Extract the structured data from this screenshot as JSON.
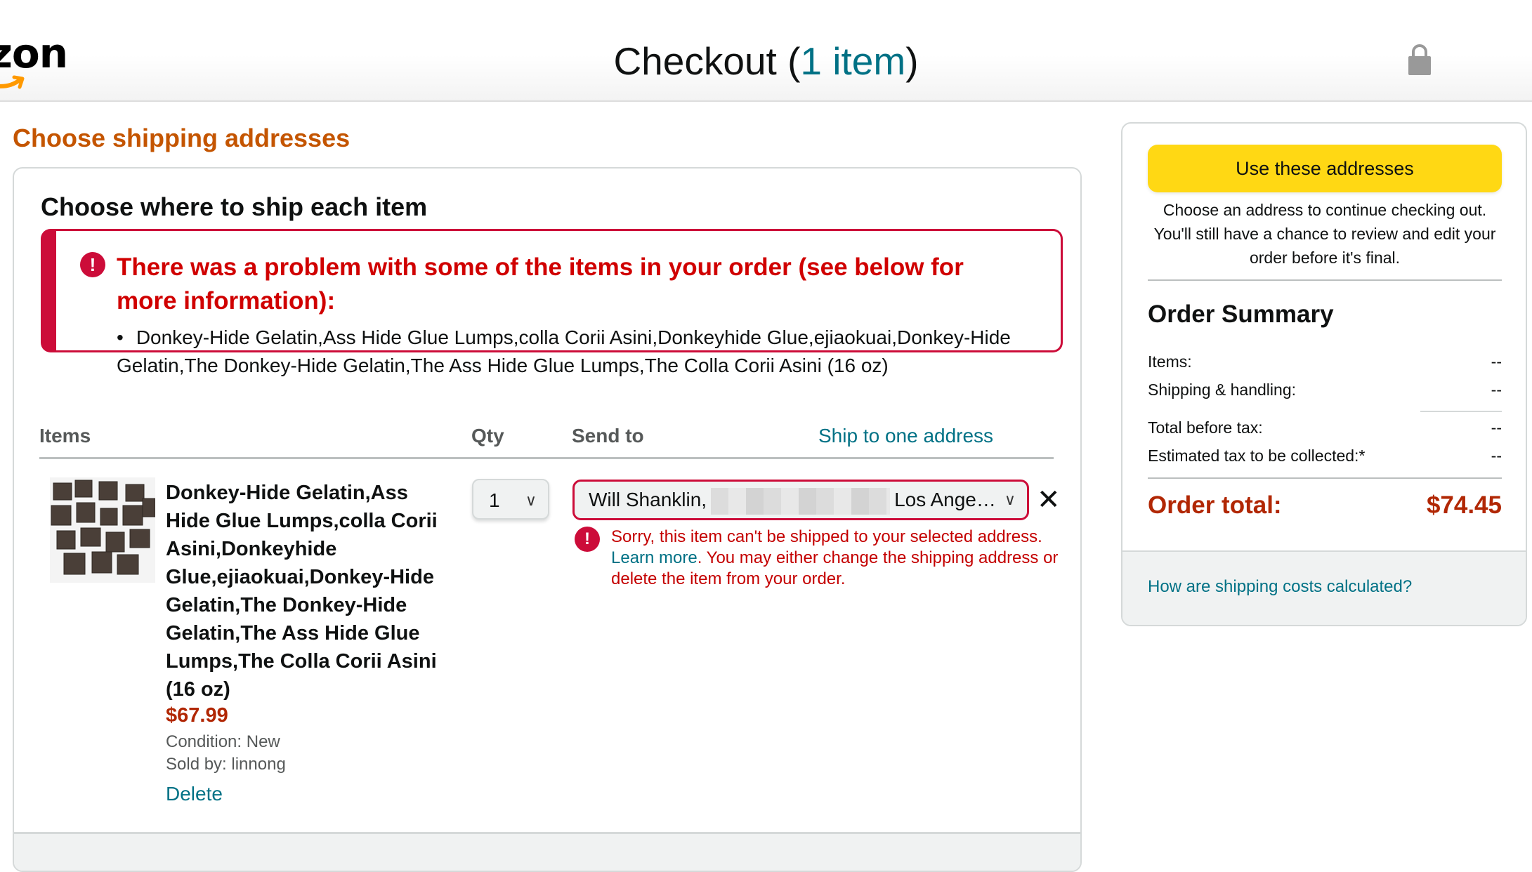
{
  "header": {
    "logo_text": "azon",
    "title": "Checkout",
    "item_count": "1 item",
    "lock_icon": "lock-icon"
  },
  "main": {
    "section_title": "Choose shipping addresses",
    "card_heading": "Choose where to ship each item",
    "alert": {
      "icon": "alert-icon",
      "title": "There was a problem with some of the items in your order (see below for more information):",
      "items": [
        "Donkey-Hide Gelatin,Ass Hide Glue Lumps,colla Corii Asini,Donkeyhide Glue,ejiaokuai,Donkey-Hide Gelatin,The Donkey-Hide Gelatin,The Ass Hide Glue Lumps,The Colla Corii Asini (16 oz)"
      ]
    },
    "columns": {
      "items": "Items",
      "qty": "Qty",
      "send_to": "Send to",
      "ship_to_one": "Ship to one address"
    },
    "item": {
      "image_alt": "Brown gelatin cubes",
      "title": "Donkey-Hide Gelatin,Ass Hide Glue Lumps,colla Corii Asini,Donkeyhide Glue,ejiaokuai,Donkey-Hide Gelatin,The Donkey-Hide Gelatin,The Ass Hide Glue Lumps,The Colla Corii Asini (16 oz)",
      "price": "$67.99",
      "condition": "Condition: New",
      "sold_by": "Sold by: linnong",
      "delete_label": "Delete",
      "qty": "1",
      "address_name": "Will Shanklin,",
      "address_city": "Los Ange…",
      "remove_label": "✕",
      "error": {
        "text1": "Sorry, this item can't be shipped to your selected address.",
        "learn_more": "Learn more",
        "text2": ". You may either change the shipping address or delete the item from your order."
      }
    }
  },
  "sidebar": {
    "use_button": "Use these addresses",
    "note": "Choose an address to continue checking out. You'll still have a chance to review and edit your order before it's final.",
    "summary_title": "Order Summary",
    "rows": [
      {
        "label": "Items:",
        "value": "--"
      },
      {
        "label": "Shipping & handling:",
        "value": "--"
      },
      {
        "label": "Total before tax:",
        "value": "--"
      },
      {
        "label": "Estimated tax to be collected:*",
        "value": "--"
      }
    ],
    "total_label": "Order total:",
    "total_value": "$74.45",
    "shipping_link": "How are shipping costs calculated?"
  },
  "colors": {
    "accent_orange": "#c45500",
    "link_teal": "#007185",
    "error_red": "#cc0c39",
    "price_red": "#b12704",
    "button_yellow": "#ffd814"
  }
}
